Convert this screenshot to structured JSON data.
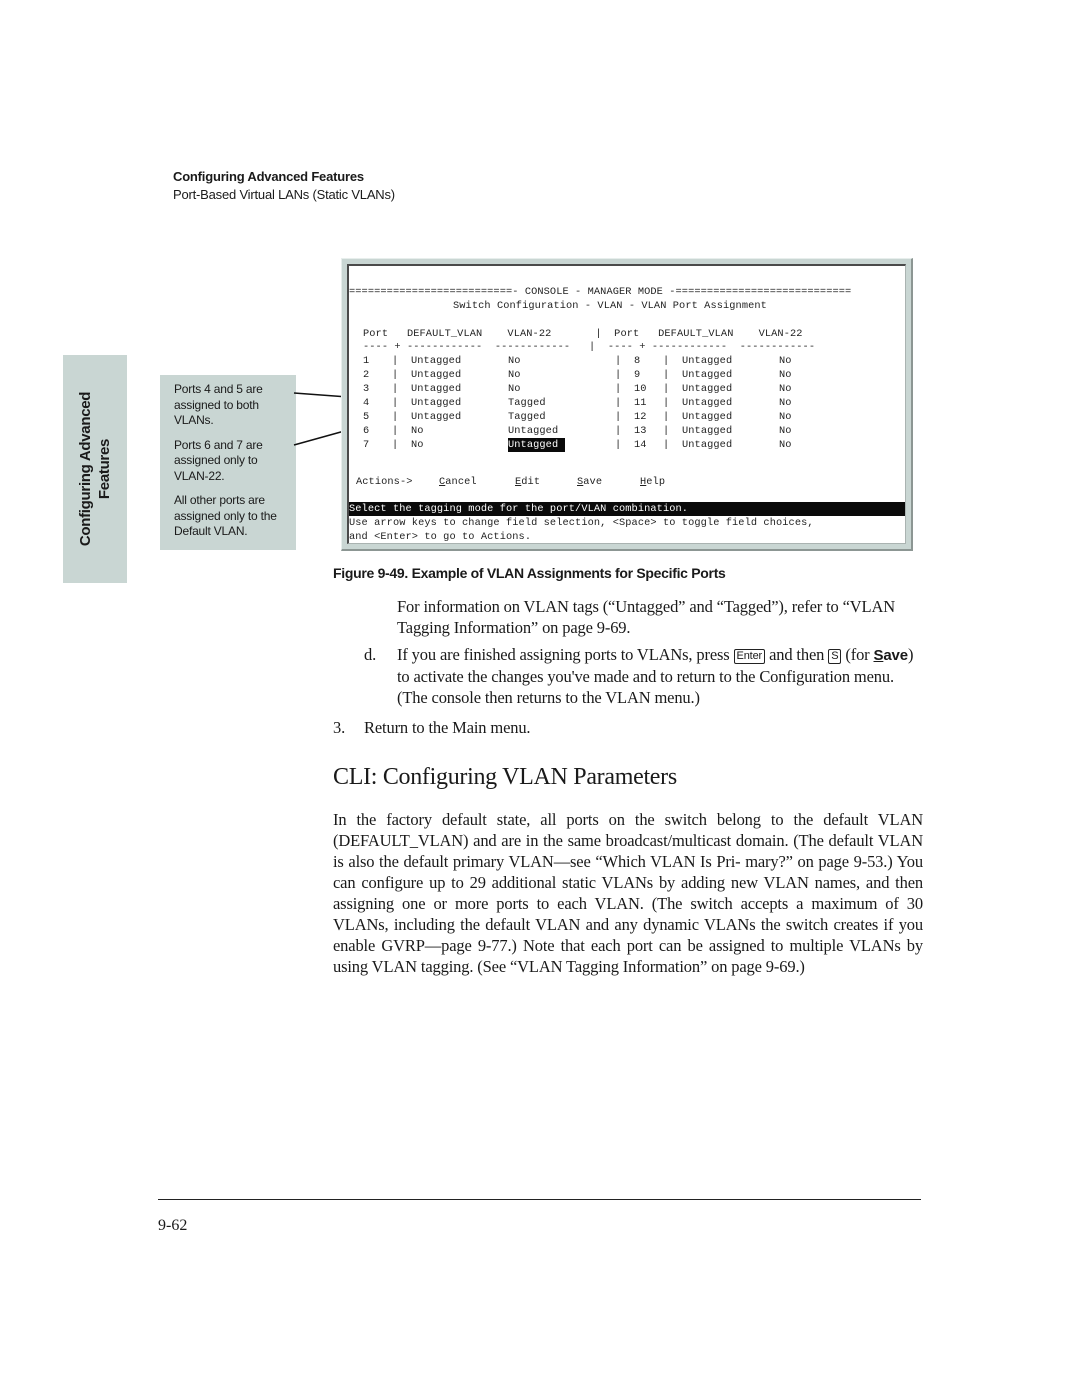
{
  "running_head": {
    "chapter": "Configuring Advanced Features",
    "section": "Port-Based Virtual LANs (Static VLANs)"
  },
  "side_tab": {
    "line1": "Configuring Advanced",
    "line2": "Features"
  },
  "callouts": [
    "Ports 4 and 5 are assigned to both VLANs.",
    "Ports 6 and 7 are assigned only to VLAN-22.",
    "All other ports are assigned only to the Default VLAN."
  ],
  "console": {
    "title_line": "==========================- CONSOLE - MANAGER MODE -============================",
    "subtitle": "Switch Configuration - VLAN - VLAN Port Assignment",
    "header": "Port   DEFAULT_VLAN    VLAN-22       |  Port   DEFAULT_VLAN    VLAN-22",
    "divider": "---- + ------------  ------------   |  ---- + ------------  ------------",
    "columns": [
      "Port",
      "DEFAULT_VLAN",
      "VLAN-22"
    ],
    "left_rows": [
      {
        "port": "1",
        "default_vlan": "Untagged",
        "vlan22": "No"
      },
      {
        "port": "2",
        "default_vlan": "Untagged",
        "vlan22": "No"
      },
      {
        "port": "3",
        "default_vlan": "Untagged",
        "vlan22": "No"
      },
      {
        "port": "4",
        "default_vlan": "Untagged",
        "vlan22": "Tagged"
      },
      {
        "port": "5",
        "default_vlan": "Untagged",
        "vlan22": "Tagged"
      },
      {
        "port": "6",
        "default_vlan": "No",
        "vlan22": "Untagged"
      },
      {
        "port": "7",
        "default_vlan": "No",
        "vlan22": "Untagged"
      }
    ],
    "right_rows": [
      {
        "port": "8",
        "default_vlan": "Untagged",
        "vlan22": "No"
      },
      {
        "port": "9",
        "default_vlan": "Untagged",
        "vlan22": "No"
      },
      {
        "port": "10",
        "default_vlan": "Untagged",
        "vlan22": "No"
      },
      {
        "port": "11",
        "default_vlan": "Untagged",
        "vlan22": "No"
      },
      {
        "port": "12",
        "default_vlan": "Untagged",
        "vlan22": "No"
      },
      {
        "port": "13",
        "default_vlan": "Untagged",
        "vlan22": "No"
      },
      {
        "port": "14",
        "default_vlan": "Untagged",
        "vlan22": "No"
      }
    ],
    "actions_label": "Actions->",
    "actions": [
      {
        "hotkey": "C",
        "rest": "ancel"
      },
      {
        "hotkey": "E",
        "rest": "dit"
      },
      {
        "hotkey": "S",
        "rest": "ave"
      },
      {
        "hotkey": "H",
        "rest": "elp"
      }
    ],
    "status_line": "Select the tagging mode for the port/VLAN combination.",
    "help_line1": "Use arrow keys to change field selection, <Space> to toggle field choices,",
    "help_line2": "and <Enter> to go to Actions."
  },
  "figure_caption": "Figure 9-49.  Example of VLAN Assignments for Specific Ports",
  "para_tags": "For information on VLAN tags (“Untagged” and “Tagged”), refer to “VLAN Tagging Information” on page 9-69.",
  "step_d": {
    "label": "d.",
    "text_before_enter": "If you are finished assigning ports to VLANs, press",
    "key_enter": "Enter",
    "text_between": "and then",
    "key_s": "S",
    "text_for": "(for",
    "save_hotkey": "S",
    "save_rest": "ave",
    "text_after": ") to activate the changes you've made and to return to the Configuration menu. (The console then returns to the VLAN menu.)"
  },
  "step_3": {
    "label": "3.",
    "text": "Return to the Main menu."
  },
  "section_heading": "CLI: Configuring VLAN Parameters",
  "section_body": "In the factory default state, all ports on the switch belong to the default VLAN (DEFAULT_VLAN) and are in the same broadcast/multicast domain.  (The default VLAN is also the default primary VLAN—see “Which VLAN Is Pri- mary?” on page 9-53.) You can configure up to 29 additional static VLANs by adding new VLAN names, and then assigning one or more ports to each VLAN. (The switch accepts a maximum of 30 VLANs, including the default VLAN and any dynamic VLANs the switch creates if you enable GVRP—page 9-77.) Note that each port can be assigned to multiple VLANs by using VLAN tagging. (See “VLAN Tagging Information” on page 9-69.)",
  "page_number": "9-62"
}
